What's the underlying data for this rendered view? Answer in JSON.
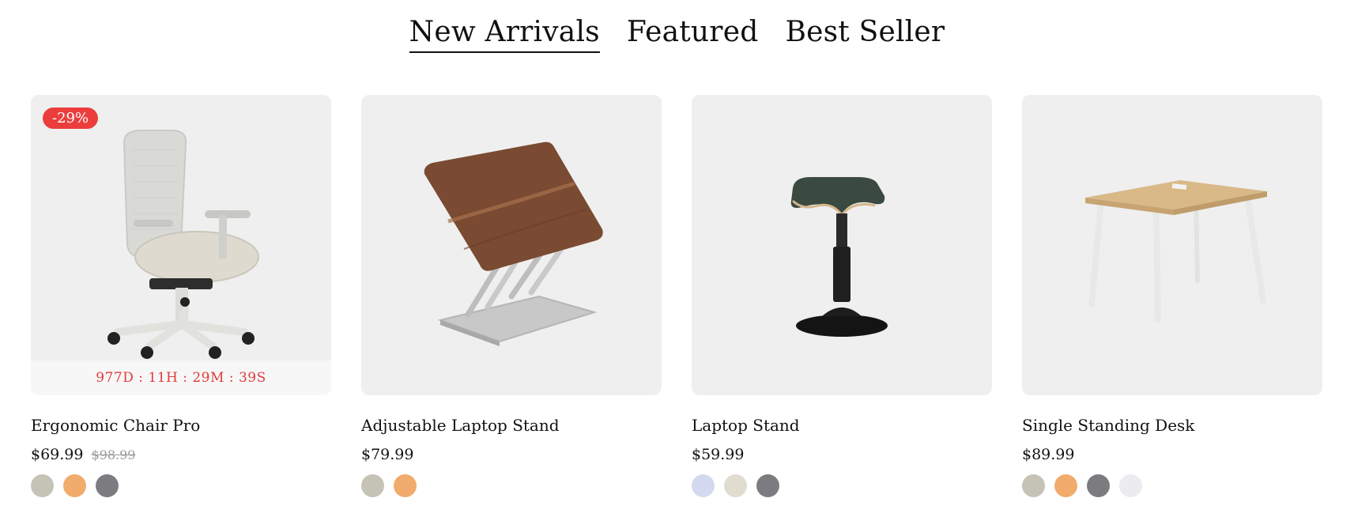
{
  "tabs": [
    {
      "label": "New Arrivals",
      "active": true
    },
    {
      "label": "Featured",
      "active": false
    },
    {
      "label": "Best Seller",
      "active": false
    }
  ],
  "products": [
    {
      "title": "Ergonomic Chair Pro",
      "price": "$69.99",
      "old_price": "$98.99",
      "badge": "-29%",
      "countdown": "977D : 11H : 29M : 39S",
      "image_icon": "office-chair-icon",
      "swatches": [
        "#c5c2b6",
        "#f0ab6d",
        "#7c7c80"
      ]
    },
    {
      "title": "Adjustable Laptop Stand",
      "price": "$79.99",
      "image_icon": "laptop-stand-icon",
      "swatches": [
        "#c5c2b6",
        "#f0ab6d"
      ]
    },
    {
      "title": "Laptop Stand",
      "price": "$59.99",
      "image_icon": "balance-stool-icon",
      "swatches": [
        "#d3d9f0",
        "#e1dcd0",
        "#7c7c80"
      ]
    },
    {
      "title": "Single Standing Desk",
      "price": "$89.99",
      "image_icon": "standing-desk-icon",
      "swatches": [
        "#c5c2b6",
        "#f0ab6d",
        "#7c7c80",
        "#ebebf0"
      ]
    }
  ],
  "colors": {
    "badge": "#ec3d3d",
    "countdown_text": "#e23b3b",
    "card_bg": "#efefef"
  }
}
